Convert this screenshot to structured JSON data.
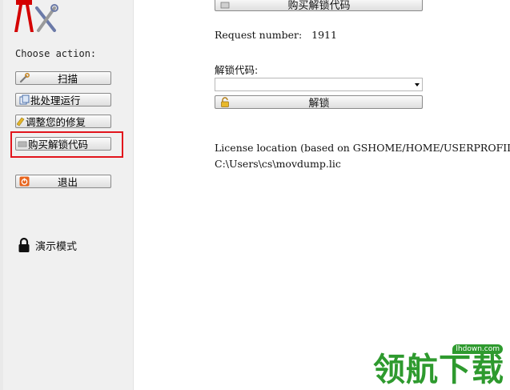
{
  "sidebar": {
    "choose_label": "Choose action:",
    "buttons": {
      "scan": "扫描",
      "batch": "批处理运行",
      "adjust": "调整您的修复",
      "buy": "购买解锁代码",
      "exit": "退出"
    },
    "demo_mode": "演示模式"
  },
  "main": {
    "buy_button": "购买解锁代码",
    "request_label": "Request number:",
    "request_number": "1911",
    "unlock_code_label": "解锁代码:",
    "unlock_code_value": "",
    "unlock_button": "解锁",
    "license_location_label": "License location (based on GSHOME/HOME/USERPROFILE)",
    "license_path": "C:\\Users\\cs\\movdump.lic"
  },
  "watermark": {
    "url": "lhdown.com",
    "text": "领航下载"
  },
  "colors": {
    "highlight_border": "#e2141c",
    "watermark_green": "#2e9a2e"
  }
}
